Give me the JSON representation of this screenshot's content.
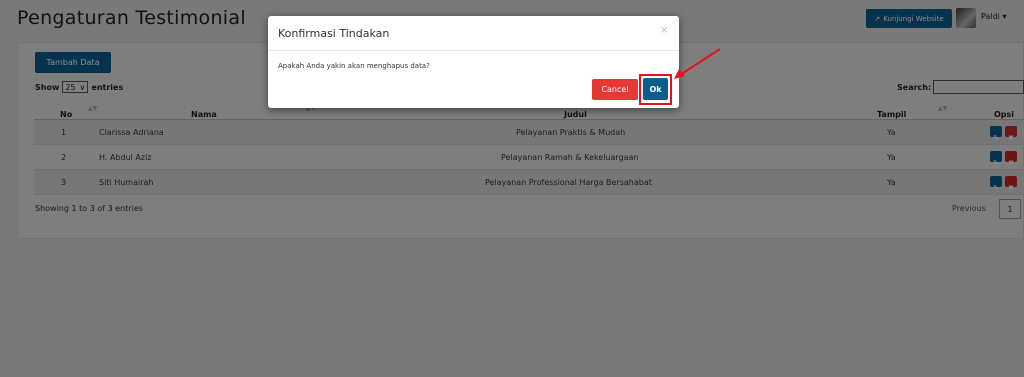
{
  "page": {
    "title": "Pengaturan Testimonial",
    "visit_site_label": "Kunjungi Website",
    "user_name": "Paldi"
  },
  "toolbar": {
    "add_label": "Tambah Data",
    "show_label": "Show",
    "entries_value": "25",
    "entries_label": "entries",
    "search_label": "Search:"
  },
  "table": {
    "columns": [
      "No",
      "Nama",
      "Judul",
      "Tampil",
      "Opsi"
    ],
    "rows": [
      {
        "no": "1",
        "nama": "Clarissa Adriana",
        "judul": "Pelayanan Praktis & Mudah",
        "tampil": "Ya"
      },
      {
        "no": "2",
        "nama": "H. Abdul Aziz",
        "judul": "Pelayanan Ramah & Kekeluargaan",
        "tampil": "Ya"
      },
      {
        "no": "3",
        "nama": "Siti Humairah",
        "judul": "Pelayanan Professional Harga Bersahabat",
        "tampil": "Ya"
      }
    ],
    "info": "Showing 1 to 3 of 3 entries",
    "previous_label": "Previous",
    "current_page": "1"
  },
  "modal": {
    "title": "Konfirmasi Tindakan",
    "close_glyph": "×",
    "message": "Apakah Anda yakin akan menghapus data?",
    "cancel_label": "Cancel",
    "ok_label": "Ok"
  },
  "colors": {
    "primary": "#0a5d8f",
    "danger": "#e53935",
    "annotation": "#e8101c"
  }
}
